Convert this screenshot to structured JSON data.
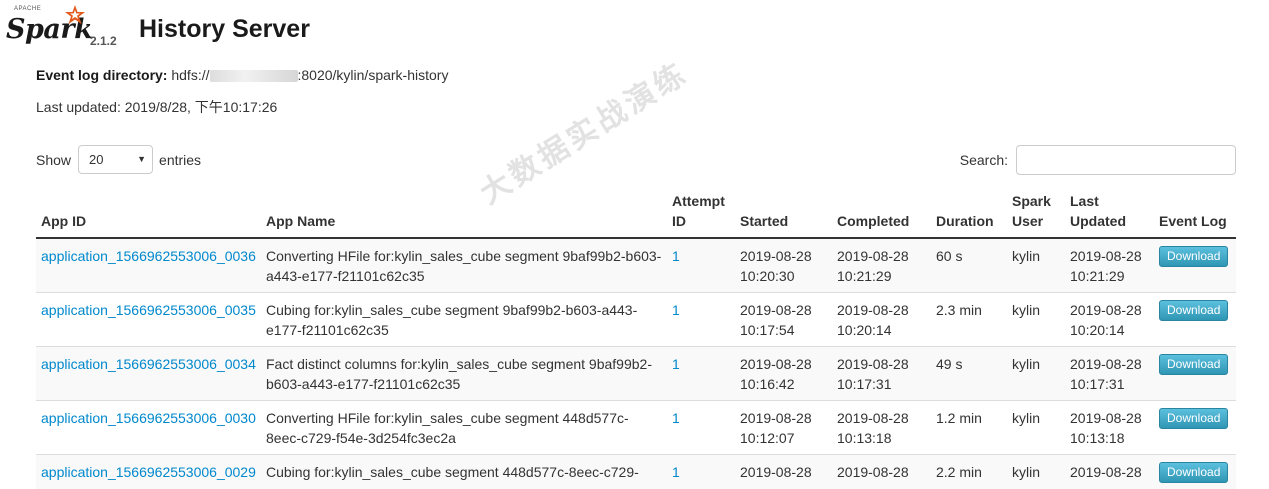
{
  "header": {
    "logo_small": "APACHE",
    "logo_word": "Spark",
    "version": "2.1.2",
    "title": "History Server"
  },
  "info": {
    "event_log_label": "Event log directory:",
    "event_log_prefix": "hdfs://",
    "event_log_suffix": ":8020/kylin/spark-history",
    "last_updated": "Last updated: 2019/8/28, 下午10:17:26"
  },
  "controls": {
    "show_label": "Show",
    "page_size": "20",
    "entries_label": "entries",
    "search_label": "Search:",
    "search_value": ""
  },
  "table": {
    "headers": [
      "App ID",
      "App Name",
      "Attempt ID",
      "Started",
      "Completed",
      "Duration",
      "Spark User",
      "Last Updated",
      "Event Log"
    ],
    "rows": [
      {
        "app_id": "application_1566962553006_0036",
        "name": "Converting HFile for:kylin_sales_cube segment 9baf99b2-b603-a443-e177-f21101c62c35",
        "attempt": "1",
        "started": "2019-08-28 10:20:30",
        "completed": "2019-08-28 10:21:29",
        "duration": "60 s",
        "user": "kylin",
        "updated": "2019-08-28 10:21:29",
        "download": "Download"
      },
      {
        "app_id": "application_1566962553006_0035",
        "name": "Cubing for:kylin_sales_cube segment 9baf99b2-b603-a443-e177-f21101c62c35",
        "attempt": "1",
        "started": "2019-08-28 10:17:54",
        "completed": "2019-08-28 10:20:14",
        "duration": "2.3 min",
        "user": "kylin",
        "updated": "2019-08-28 10:20:14",
        "download": "Download"
      },
      {
        "app_id": "application_1566962553006_0034",
        "name": "Fact distinct columns for:kylin_sales_cube segment 9baf99b2-b603-a443-e177-f21101c62c35",
        "attempt": "1",
        "started": "2019-08-28 10:16:42",
        "completed": "2019-08-28 10:17:31",
        "duration": "49 s",
        "user": "kylin",
        "updated": "2019-08-28 10:17:31",
        "download": "Download"
      },
      {
        "app_id": "application_1566962553006_0030",
        "name": "Converting HFile for:kylin_sales_cube segment 448d577c-8eec-c729-f54e-3d254fc3ec2a",
        "attempt": "1",
        "started": "2019-08-28 10:12:07",
        "completed": "2019-08-28 10:13:18",
        "duration": "1.2 min",
        "user": "kylin",
        "updated": "2019-08-28 10:13:18",
        "download": "Download"
      },
      {
        "app_id": "application_1566962553006_0029",
        "name": "Cubing for:kylin_sales_cube segment 448d577c-8eec-c729-",
        "attempt": "1",
        "started": "2019-08-28",
        "completed": "2019-08-28",
        "duration": "2.2 min",
        "user": "kylin",
        "updated": "2019-08-28",
        "download": "Download"
      }
    ]
  },
  "watermark": "大数据实战演练",
  "colors": {
    "link": "#0088cc",
    "button": "#5bc0de",
    "stripe": "#f9f9f9"
  }
}
